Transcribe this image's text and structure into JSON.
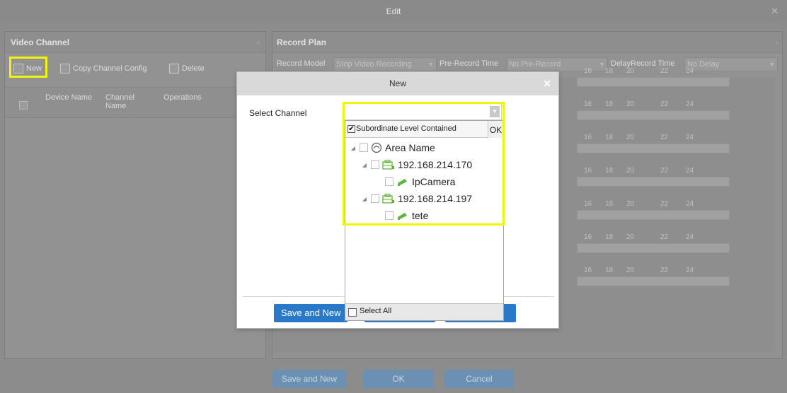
{
  "window": {
    "title": "Edit"
  },
  "video_channel": {
    "title": "Video Channel",
    "toolbar": {
      "new_label": "New",
      "copy_label": "Copy Channel Config",
      "delete_label": "Delete"
    },
    "columns": [
      "Device Name",
      "Channel\nName",
      "Operations"
    ]
  },
  "record_plan": {
    "title": "Record Plan",
    "record_model_label": "Record Model",
    "record_model_value": "Stop Video Recording",
    "pre_record_label": "Pre-Record Time",
    "pre_record_value": "No Pre-Record",
    "delay_label": "DelayRecord Time",
    "delay_value": "No Delay",
    "hours": [
      "16",
      "18",
      "20",
      "22",
      "24"
    ]
  },
  "footer": {
    "save_new": "Save and New",
    "ok": "OK",
    "cancel": "Cancel"
  },
  "modal": {
    "title": "New",
    "select_channel_label": "Select Channel",
    "save_new_label": "Save and New"
  },
  "dropdown": {
    "subordinate_label": "Subordinate Level Contained",
    "subordinate_checked": true,
    "ok_label": "OK",
    "select_all_label": "Select All",
    "tree": [
      {
        "label": "Area Name",
        "icon": "area-icon"
      },
      {
        "label": "192.168.214.170",
        "icon": "device-icon"
      },
      {
        "label": "IpCamera",
        "icon": "camera-icon"
      },
      {
        "label": "192.168.214.197",
        "icon": "device-icon"
      },
      {
        "label": "tete",
        "icon": "camera-icon"
      }
    ]
  },
  "colors": {
    "highlight": "#f5f50a",
    "primary": "#2a78c8",
    "icon_green": "#5fb534"
  }
}
